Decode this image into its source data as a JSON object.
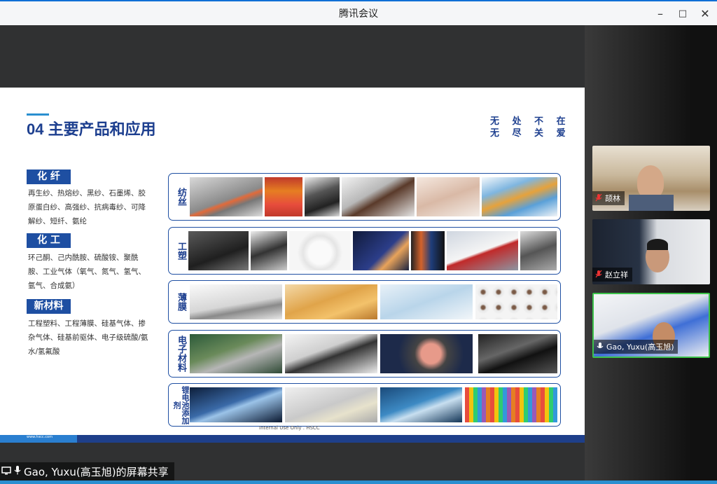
{
  "window": {
    "title": "腾讯会议"
  },
  "slide": {
    "heading": "04 主要产品和应用",
    "slogan_lines": [
      "无 处 不 在",
      "无 尽 关 爱"
    ],
    "categories": [
      {
        "label": "化 纤",
        "text": "再生纱、热熔纱、黑纱、石墨烯、胶原蛋白纱、高强纱、抗病毒纱、可降解纱、短纤、氨纶"
      },
      {
        "label": "化 工",
        "text": "环己酮、己内酰胺、硫酸铵、聚酰胺、工业气体（氧气、氮气、氢气、氩气、合成氨）"
      },
      {
        "label": "新材料",
        "text": "工程塑料、工程薄膜、硅基气体、掺杂气体、硅基前驱体、电子级硫酸/氨水/氢氟酸"
      }
    ],
    "rows": [
      {
        "label": "纺丝"
      },
      {
        "label": "工塑"
      },
      {
        "label": "薄膜"
      },
      {
        "label": "电子材料"
      },
      {
        "label": "锂电池添加剂"
      }
    ],
    "footer": "Internal Use Only . HSCC",
    "url": "www.hscc.com"
  },
  "participants": [
    {
      "name": "颉林",
      "mic": "muted"
    },
    {
      "name": "赵立祥",
      "mic": "muted"
    },
    {
      "name": "Gao, Yuxu(高玉旭)",
      "mic": "active"
    }
  ],
  "share_status": "Gao, Yuxu(高玉旭)的屏幕共享",
  "colors": {
    "accent": "#1e4fa2",
    "title_bar_accent": "#0f6fd6",
    "active_speaker": "#3cc24a"
  }
}
